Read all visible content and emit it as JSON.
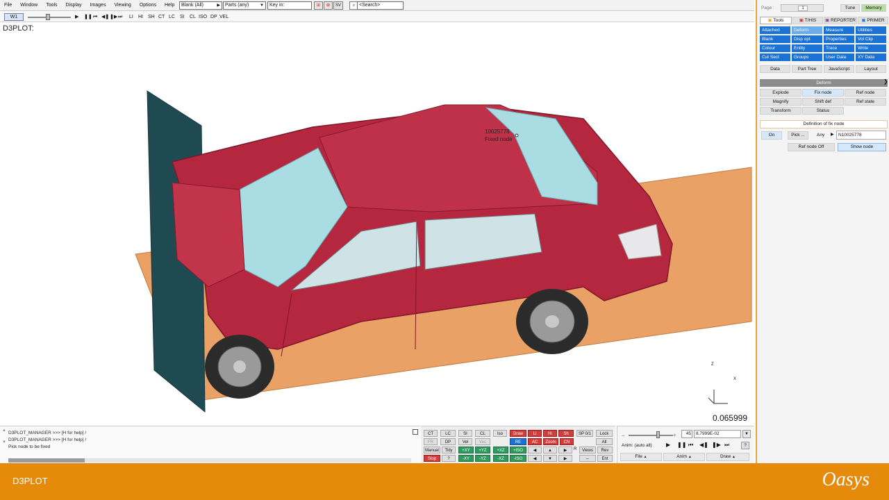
{
  "menu": {
    "items": [
      "File",
      "Window",
      "Tools",
      "Display",
      "Images",
      "Viewing",
      "Options",
      "Help"
    ],
    "blank_select": "Blank (All)",
    "parts_select": "Parts (any)",
    "key_in": "Key in:",
    "sv_label": "SV",
    "search_placeholder": "<Search>"
  },
  "animbar": {
    "window_tab": "W1",
    "controls": [
      "LI",
      "HI",
      "SH",
      "CT",
      "LC",
      "SI",
      "CL",
      "ISO",
      "DP",
      "VEL"
    ]
  },
  "viewport": {
    "label": "D3PLOT:",
    "time_value": "0.065999",
    "node_label": "10025778",
    "node_caption": "Fixed node",
    "triad": {
      "z": "Z",
      "x": "X"
    }
  },
  "rpanel": {
    "page_label": "Page :",
    "page_value": "1",
    "tune": "Tune",
    "memory": "Memory",
    "tabs": [
      "Tools",
      "T/HIS",
      "REPORTER",
      "PRIMER"
    ],
    "tools_grid": [
      [
        "Attached",
        "Deform",
        "Measure",
        "Utilities"
      ],
      [
        "Blank",
        "Disp opt",
        "Properties",
        "Vol Clip"
      ],
      [
        "Colour",
        "Entity",
        "Trace",
        "Write"
      ],
      [
        "Cut Sect",
        "Groups",
        "User Data",
        "XY Data"
      ]
    ],
    "bottom_tabs": [
      "Data",
      "Part Tree",
      "JavaScript",
      "Layout"
    ],
    "deform_title": "Deform",
    "deform_buttons": [
      [
        "Explode",
        "Fix node",
        "Ref node"
      ],
      [
        "Magnify",
        "Shift def",
        "Ref state"
      ],
      [
        "Transform",
        "Status",
        ""
      ]
    ],
    "fix_section_title": "Definition of fix node",
    "on_label": "On",
    "pick_label": "Pick ...",
    "any_label": "Any",
    "node_value": "N10025778",
    "ref_node_off": "Ref node Off",
    "show_node": "Show node"
  },
  "console": {
    "lines": [
      "D3PLOT_MANAGER >>> [H for help] /",
      "D3PLOT_MANAGER >>> [H for help] /",
      "Pick node to be fixed"
    ]
  },
  "cmd": {
    "row1": [
      "CT",
      "LC",
      "SI",
      "CL",
      "Iso",
      "Draw",
      "Li",
      "Hi",
      "Sh",
      "SP 0/1",
      "Lock"
    ],
    "row2": [
      "FR",
      "DP",
      "Vel",
      "Vec",
      "RE",
      "AC",
      "Zoom",
      "CN",
      "All"
    ],
    "row3": [
      "Manual",
      "Tidy",
      "+XY",
      "+YZ",
      "+XZ",
      "+ISO",
      "R",
      "Views",
      "Rev"
    ],
    "row4": [
      "Stop",
      "?",
      "-XY",
      "-YZ",
      "-XZ",
      "-ISO",
      "Ent"
    ]
  },
  "play": {
    "state": "45",
    "time": "8.7999E-02",
    "anim_mode": "Anim: (auto all)",
    "help": "?",
    "menus": [
      "File",
      "Anim",
      "Draw"
    ]
  },
  "footer": {
    "left": "D3PLOT",
    "right": "Oasys"
  }
}
